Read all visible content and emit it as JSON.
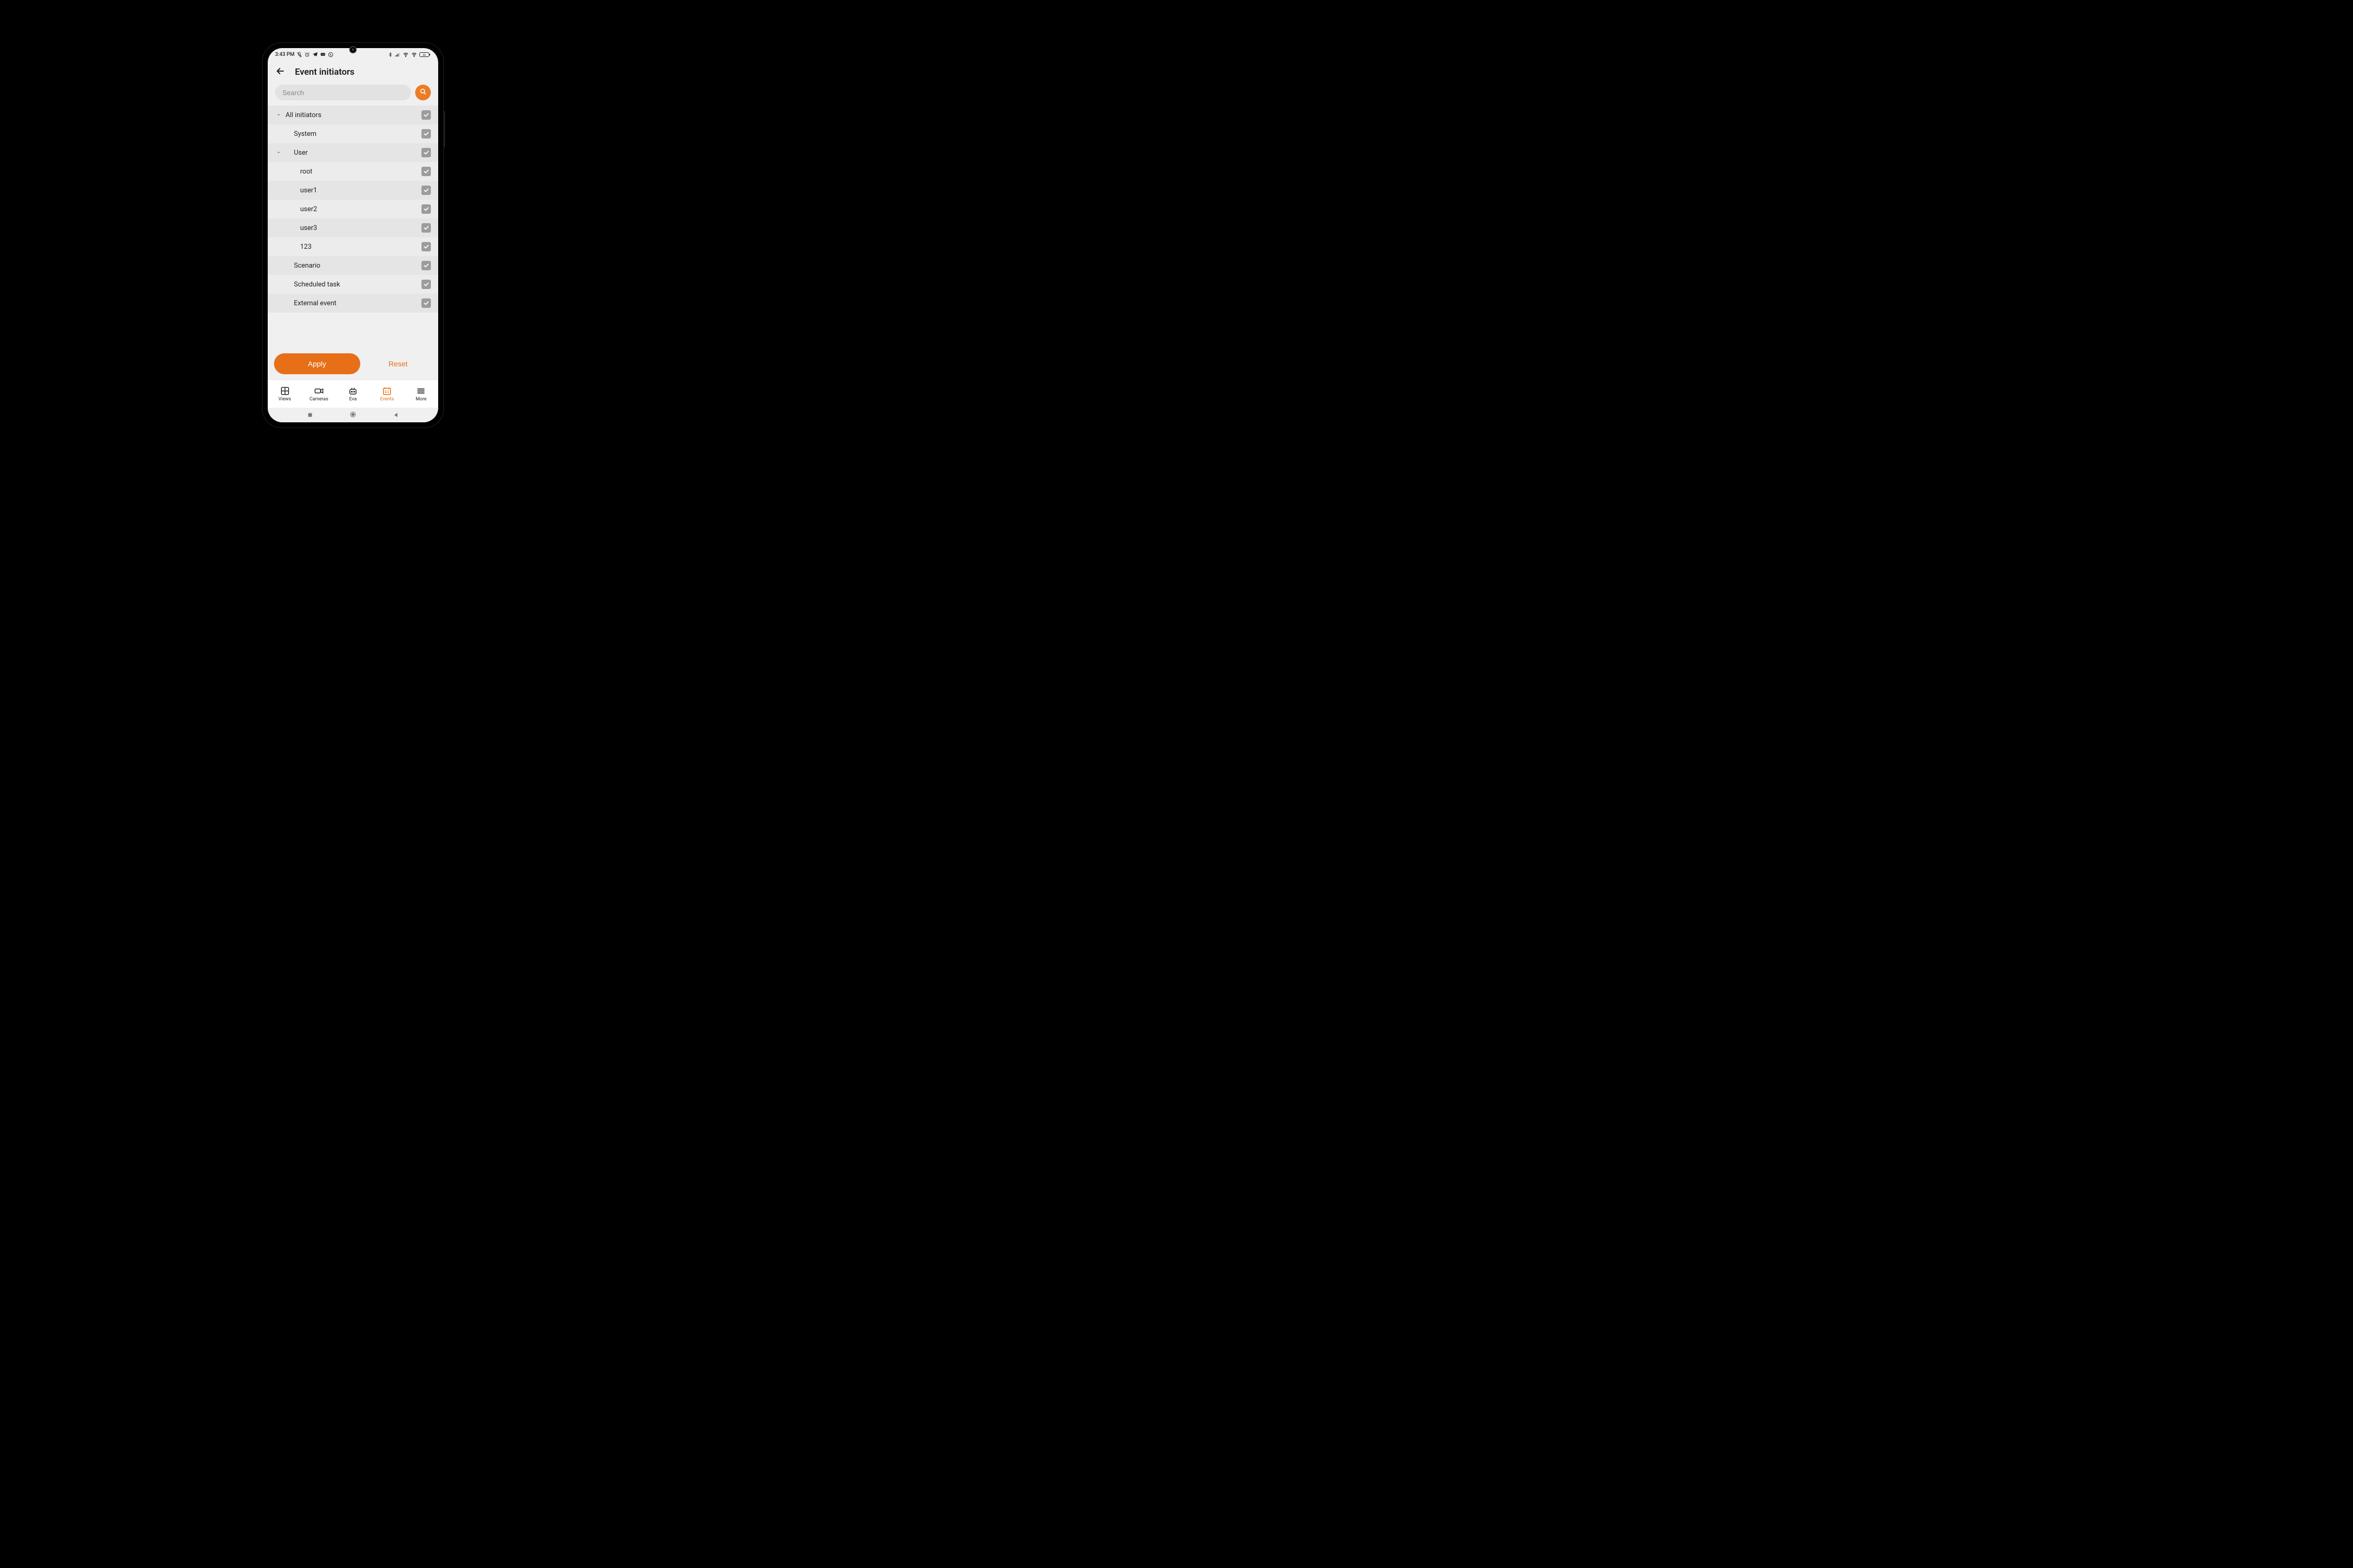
{
  "status": {
    "time": "3:43 PM",
    "battery": "66"
  },
  "header": {
    "title": "Event initiators"
  },
  "search": {
    "placeholder": "Search"
  },
  "rows": [
    {
      "label": "All initiators",
      "indent": 0,
      "chevron": true,
      "checked": true,
      "shade": "a"
    },
    {
      "label": "System",
      "indent": 1,
      "chevron": false,
      "checked": true,
      "shade": "b"
    },
    {
      "label": "User",
      "indent": 1,
      "chevron": true,
      "checked": true,
      "shade": "a"
    },
    {
      "label": "root",
      "indent": 2,
      "chevron": false,
      "checked": true,
      "shade": "b"
    },
    {
      "label": "user1",
      "indent": 2,
      "chevron": false,
      "checked": true,
      "shade": "a"
    },
    {
      "label": "user2",
      "indent": 2,
      "chevron": false,
      "checked": true,
      "shade": "b"
    },
    {
      "label": "user3",
      "indent": 2,
      "chevron": false,
      "checked": true,
      "shade": "a"
    },
    {
      "label": "123",
      "indent": 2,
      "chevron": false,
      "checked": true,
      "shade": "b"
    },
    {
      "label": "Scenario",
      "indent": 1,
      "chevron": false,
      "checked": true,
      "shade": "a"
    },
    {
      "label": "Scheduled task",
      "indent": 1,
      "chevron": false,
      "checked": true,
      "shade": "b"
    },
    {
      "label": "External event",
      "indent": 1,
      "chevron": false,
      "checked": true,
      "shade": "a"
    }
  ],
  "actions": {
    "apply": "Apply",
    "reset": "Reset"
  },
  "nav": {
    "views": "Views",
    "cameras": "Cameras",
    "eva": "Eva",
    "events": "Events",
    "more": "More"
  }
}
